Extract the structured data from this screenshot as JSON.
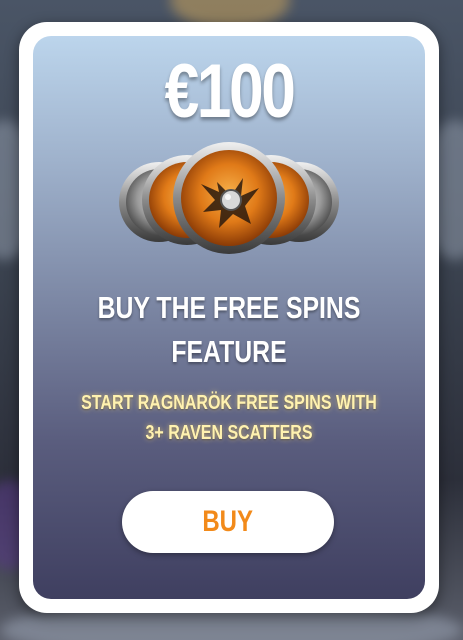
{
  "offer": {
    "price": "€100",
    "title_line1": "BUY THE FREE SPINS",
    "title_line2": "FEATURE",
    "subtitle_line1": "START RAGNARÖK FREE SPINS WITH",
    "subtitle_line2": "3+ RAVEN SCATTERS",
    "icon": "raven-shield-coins-icon"
  },
  "buy_button": {
    "label": "BUY"
  },
  "colors": {
    "buy_label": "#f28a1a",
    "subtitle": "#fff2b0",
    "frame": "#ffffff"
  }
}
